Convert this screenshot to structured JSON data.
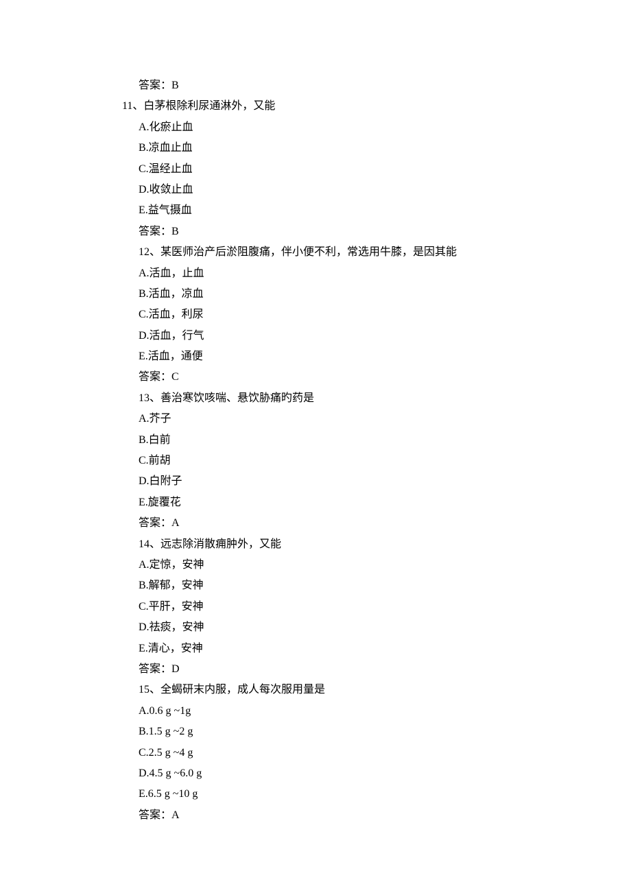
{
  "q10": {
    "answer_label": "答案：B"
  },
  "q11": {
    "stem": "11、白茅根除利尿通淋外，又能",
    "A": "A.化瘀止血",
    "B": "B.凉血止血",
    "C": "C.温经止血",
    "D": "D.收敛止血",
    "E": "E.益气摄血",
    "answer_label": "答案：B"
  },
  "q12": {
    "stem": "12、某医师治产后淤阻腹痛，伴小便不利，常选用牛膝，是因其能",
    "A": "A.活血，止血",
    "B": "B.活血，凉血",
    "C": "C.活血，利尿",
    "D": "D.活血，行气",
    "E": "E.活血，通便",
    "answer_label": "答案：C"
  },
  "q13": {
    "stem": "13、善治寒饮咳喘、悬饮胁痛旳药是",
    "A": "A.芥子",
    "B": "B.白前",
    "C": "C.前胡",
    "D": "D.白附子",
    "E": "E.旋覆花",
    "answer_label": "答案：A"
  },
  "q14": {
    "stem": "14、远志除消散痈肿外，又能",
    "A": "A.定惊，安神",
    "B": "B.解郁，安神",
    "C": "C.平肝，安神",
    "D": "D.祛痰，安神",
    "E": "E.清心，安神",
    "answer_label": "答案：D"
  },
  "q15": {
    "stem": "15、全蝎研末内服，成人每次服用量是",
    "A": "A.0.6 g ~1g",
    "B": "B.1.5 g ~2 g",
    "C": "C.2.5 g ~4 g",
    "D": "D.4.5 g ~6.0 g",
    "E": "E.6.5 g ~10 g",
    "answer_label": "答案：A"
  }
}
